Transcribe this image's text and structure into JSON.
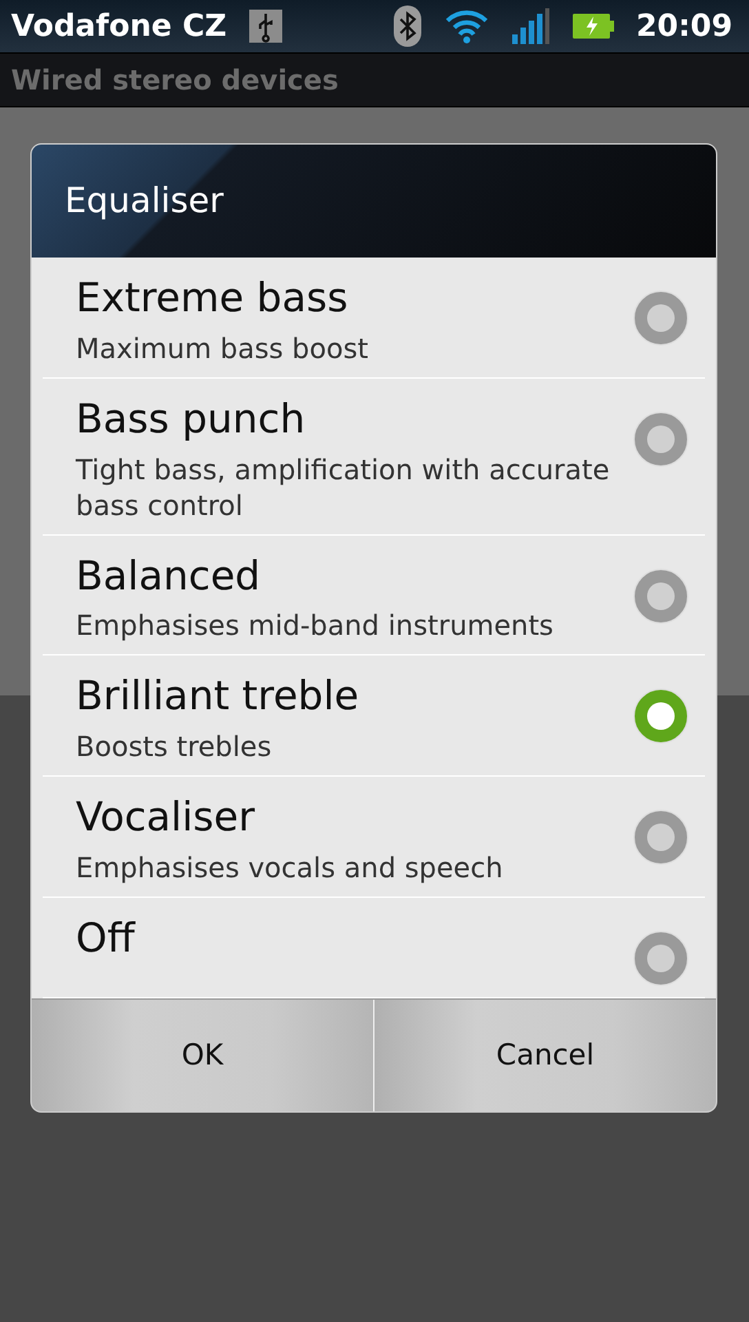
{
  "status_bar": {
    "carrier": "Vodafone CZ",
    "time": "20:09"
  },
  "screen": {
    "title": "Wired stereo devices"
  },
  "dialog": {
    "title": "Equaliser",
    "options": [
      {
        "label": "Extreme bass",
        "description": "Maximum bass boost",
        "selected": false
      },
      {
        "label": "Bass punch",
        "description": "Tight bass, amplification with accurate bass control",
        "selected": false
      },
      {
        "label": "Balanced",
        "description": "Emphasises mid-band instruments",
        "selected": false
      },
      {
        "label": "Brilliant treble",
        "description": "Boosts trebles",
        "selected": true
      },
      {
        "label": "Vocaliser",
        "description": "Emphasises vocals and speech",
        "selected": false
      },
      {
        "label": "Off",
        "selected": false
      }
    ],
    "buttons": [
      "OK",
      "Cancel"
    ]
  }
}
